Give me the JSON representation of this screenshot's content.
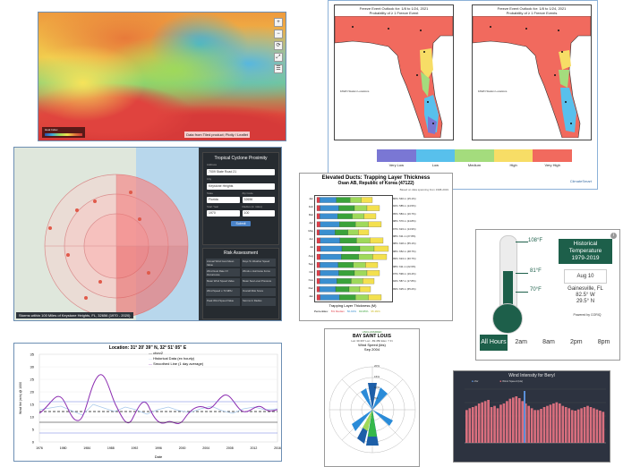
{
  "panel1": {
    "controls": [
      "+",
      "−",
      "⟳",
      "⤢",
      "☰"
    ],
    "legend": {
      "label": "Heat Index"
    },
    "attribution": "Data from Tiled product; Plotly / Leaflet"
  },
  "panel2": {
    "map_left_title": [
      "Freeze Event Outlook for: 1/8 to 1/24, 2021",
      "Probability of ≥ 1 Freeze Event"
    ],
    "map_right_title": [
      "Freeze Event Outlook for: 1/8 to 1/24, 2021",
      "Probability of ≥ 1 Freeze Events"
    ],
    "station_label": "FAWN Station Locations",
    "legend": [
      {
        "label": "Very Low",
        "color": "#7a77d4"
      },
      {
        "label": "Low",
        "color": "#58c0ec"
      },
      {
        "label": "Medium",
        "color": "#a4dc7d"
      },
      {
        "label": "High",
        "color": "#f7dd66"
      },
      {
        "label": "Very High",
        "color": "#f16a5e"
      }
    ],
    "logo": "ClimateSmart"
  },
  "panel3": {
    "form_title": "Tropical Cyclone Proximity",
    "fields": [
      {
        "label": "Address",
        "value": "7009 State Road 21"
      },
      {
        "label": "City",
        "value": "Keystone Heights"
      }
    ],
    "row_fields": [
      {
        "label": "State",
        "value": "Florida"
      },
      {
        "label": "Zip Code",
        "value": "32656"
      },
      {
        "label": "Start Year",
        "value": "1970"
      },
      {
        "label": "Radius (in miles)",
        "value": "100"
      }
    ],
    "submit": "Submit",
    "risk_title": "Risk Assessment",
    "risk_cells": [
      "Annual Wind Gust Mean Value",
      "Days To Weather Speed",
      "Wind Gust Rate Of Occurrence",
      "Winds ≥ Hurricane Force",
      "Mean Wind Speed Value",
      "Mean Sea Level Pressure",
      "Wind Speed ≥ 74 MPH",
      "Overall Risk Score",
      "Peak Wind Speed Value",
      "Storms In Radius"
    ],
    "caption": "Storms within 100 Miles of Keystone Heights, FL, 32656 (1970 - 2020)"
  },
  "panel4": {
    "title": "Elevated Ducts: Trapping Layer Thickness",
    "subtitle": "Osan AB, Republic of Korea (47122)",
    "note": "Based on data spanning from 1998-2019",
    "rows": [
      "Jan",
      "Feb",
      "Mar",
      "Apr",
      "May",
      "Jun",
      "Jul",
      "Aug",
      "Sep",
      "Oct",
      "Nov",
      "Dec",
      "Jan"
    ],
    "stats": [
      "80%: 540 m (15.1%)",
      "92%: 585 m (14.5%)",
      "95%: 583 m (16.7%)",
      "98%: 570 m (24.8%)",
      "97%: 623 m (14.9%)",
      "98%: 611 m (27.8%)",
      "98%: 618 m (55.1%)",
      "98%: 652 m (48.7%)",
      "99%: 624 m (30.7%)",
      "98%: 611 m (22.6%)",
      "97%: 596 m (19.4%)",
      "94%: 587 m (17.8%)",
      "99%: 625 m (65.2%)"
    ],
    "xlabel": "Trapping Layer Thickness (M)",
    "percentiles": [
      "Percentiles:",
      "5% Median",
      "50-90%",
      "90-95%",
      "95-99%"
    ]
  },
  "panel5": {
    "ticks": {
      "high": "108°F",
      "mid": "81°F",
      "low": "70°F"
    },
    "historical": [
      "Historical",
      "Temperature",
      "1979-2019"
    ],
    "date": "Aug 10",
    "location": [
      "Gainesville, FL",
      "82.5° W",
      "29.5° N"
    ],
    "powered_by": "Powered by CORIQ",
    "tabs": [
      "All Hours",
      "2am",
      "8am",
      "2pm",
      "8pm"
    ]
  },
  "panel6": {
    "location": "Location: 31° 20' 39\" N, 32° 51' 05\" E",
    "legend": [
      "cforv2",
      "Historical Data  (ex hourly)",
      "Smoothed Line  (1 day average)"
    ],
    "ylabel": "Wind Vel (m/s) @ 1000",
    "xlabel": "Date",
    "x_ticks": [
      "1976",
      "1978",
      "1980",
      "1982",
      "1984",
      "1986",
      "1988",
      "1990",
      "1992",
      "1994",
      "1996",
      "1998",
      "2000",
      "2002",
      "2004",
      "2006",
      "2008",
      "2010",
      "2012",
      "2014",
      "2016"
    ],
    "y_ticks": [
      "0",
      "5",
      "10",
      "15",
      "20",
      "25",
      "30",
      "35"
    ]
  },
  "panel7": {
    "classification": "UNCLASSIFIED",
    "title": "BAY SAINT LOUIS",
    "coords": "Lat: 30.367 Lon: -89.450 Elev: 7 Ft",
    "subtitle": "Wind Speed (kts)",
    "period": "Sep 2004",
    "rings": [
      "5%",
      "10%",
      "15%",
      "20%",
      "22.5%"
    ]
  },
  "panel8": {
    "title": "Wind Intensity for Beryl",
    "legend": [
      "cfsr",
      "Wind Speed (kts)"
    ],
    "bars": [
      55,
      58,
      60,
      62,
      66,
      68,
      70,
      72,
      60,
      62,
      58,
      64,
      66,
      70,
      74,
      76,
      78,
      75,
      70,
      66,
      62,
      58,
      55,
      55,
      57,
      60,
      62,
      64,
      66,
      68,
      66,
      62,
      60,
      58,
      55,
      54,
      56,
      58,
      60,
      62,
      60,
      58,
      56,
      54,
      52
    ]
  }
}
